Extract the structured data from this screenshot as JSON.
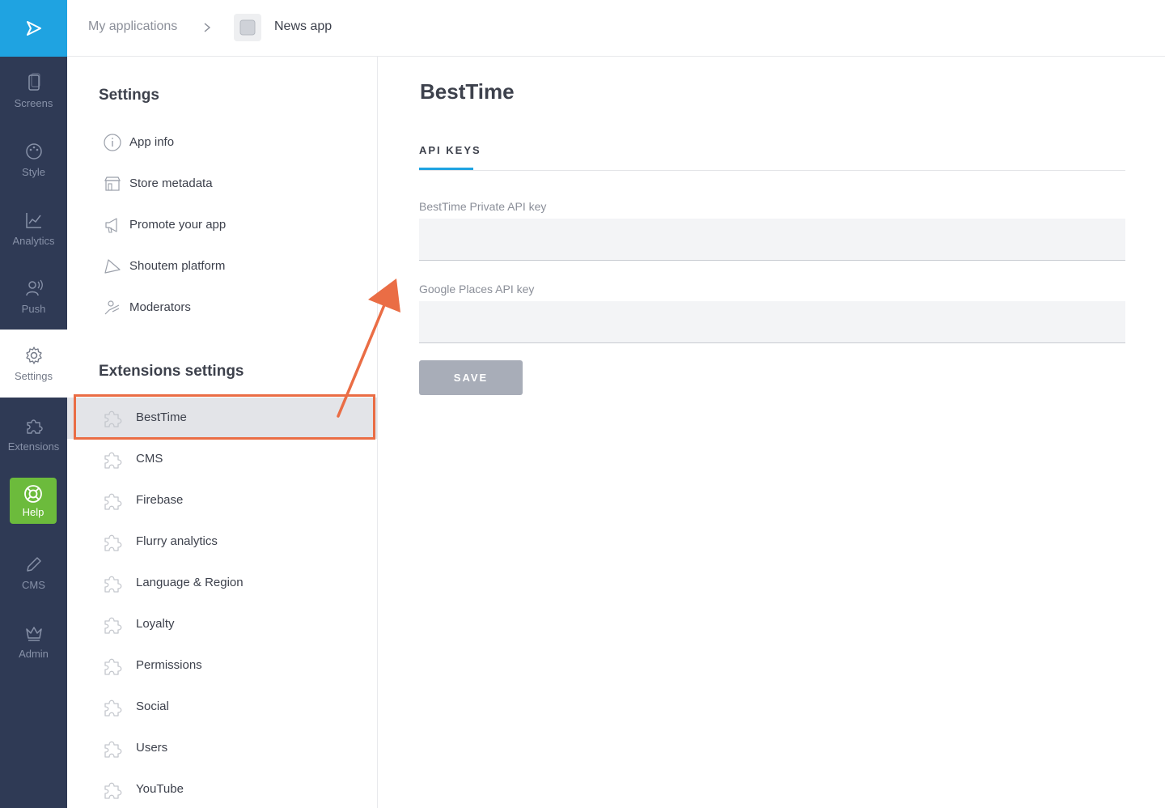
{
  "rail": {
    "items": [
      {
        "label": "Screens"
      },
      {
        "label": "Style"
      },
      {
        "label": "Analytics"
      },
      {
        "label": "Push"
      },
      {
        "label": "Settings"
      },
      {
        "label": "Extensions"
      },
      {
        "label": "Help"
      },
      {
        "label": "CMS"
      },
      {
        "label": "Admin"
      }
    ]
  },
  "breadcrumb": {
    "root": "My applications",
    "current": "News app"
  },
  "settings": {
    "title": "Settings",
    "items": [
      {
        "label": "App info",
        "icon": "info-icon"
      },
      {
        "label": "Store metadata",
        "icon": "store-icon"
      },
      {
        "label": "Promote your app",
        "icon": "megaphone-icon"
      },
      {
        "label": "Shoutem platform",
        "icon": "shoutem-icon"
      },
      {
        "label": "Moderators",
        "icon": "moderator-icon"
      }
    ]
  },
  "extensions": {
    "title": "Extensions settings",
    "selected": "BestTime",
    "items": [
      {
        "label": "BestTime"
      },
      {
        "label": "CMS"
      },
      {
        "label": "Firebase"
      },
      {
        "label": "Flurry analytics"
      },
      {
        "label": "Language & Region"
      },
      {
        "label": "Loyalty"
      },
      {
        "label": "Permissions"
      },
      {
        "label": "Social"
      },
      {
        "label": "Users"
      },
      {
        "label": "YouTube"
      }
    ]
  },
  "main": {
    "title": "BestTime",
    "tab": "API KEYS",
    "fields": [
      {
        "label": "BestTime Private API key",
        "value": ""
      },
      {
        "label": "Google Places API key",
        "value": ""
      }
    ],
    "save_label": "SAVE"
  },
  "colors": {
    "rail_bg": "#2f3a55",
    "brand_blue": "#1fa3e1",
    "help_green": "#6cbb3c",
    "annotation_orange": "#ea6d45",
    "button_gray": "#a8adb8"
  }
}
